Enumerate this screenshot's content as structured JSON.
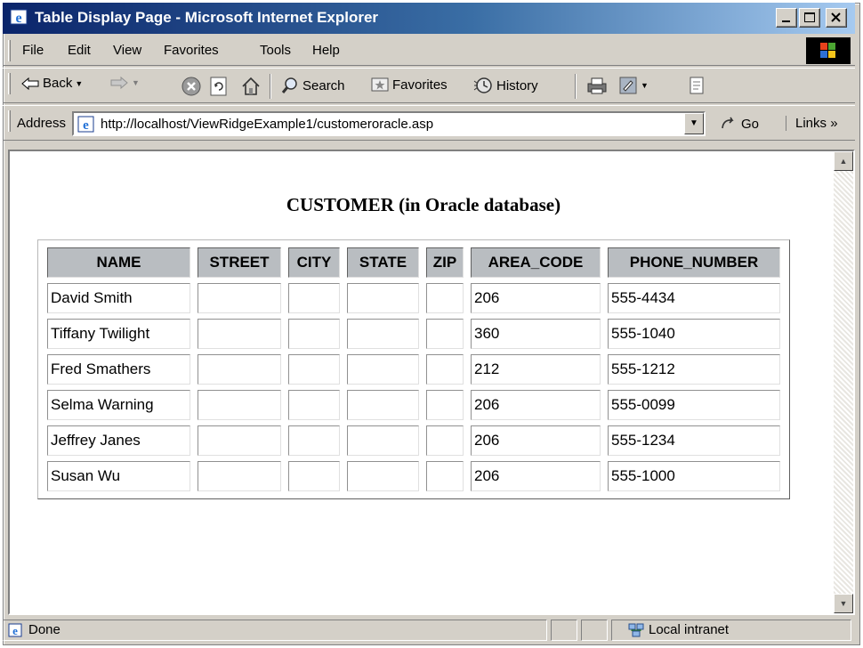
{
  "window": {
    "title": "Table Display Page - Microsoft Internet Explorer"
  },
  "menu": [
    "File",
    "Edit",
    "View",
    "Favorites",
    "Tools",
    "Help"
  ],
  "toolbar": {
    "back": "Back",
    "search": "Search",
    "favorites": "Favorites",
    "history": "History"
  },
  "address": {
    "label": "Address",
    "url": "http://localhost/ViewRidgeExample1/customeroracle.asp",
    "go": "Go",
    "links": "Links"
  },
  "page": {
    "heading": "CUSTOMER (in Oracle database)",
    "columns": [
      "NAME",
      "STREET",
      "CITY",
      "STATE",
      "ZIP",
      "AREA_CODE",
      "PHONE_NUMBER"
    ],
    "rows": [
      [
        "David Smith",
        "",
        "",
        "",
        "",
        "206",
        "555-4434"
      ],
      [
        "Tiffany Twilight",
        "",
        "",
        "",
        "",
        "360",
        "555-1040"
      ],
      [
        "Fred Smathers",
        "",
        "",
        "",
        "",
        "212",
        "555-1212"
      ],
      [
        "Selma Warning",
        "",
        "",
        "",
        "",
        "206",
        "555-0099"
      ],
      [
        "Jeffrey Janes",
        "",
        "",
        "",
        "",
        "206",
        "555-1234"
      ],
      [
        "Susan Wu",
        "",
        "",
        "",
        "",
        "206",
        "555-1000"
      ]
    ]
  },
  "status": {
    "text": "Done",
    "zone": "Local intranet"
  },
  "colors": {
    "titlebar_start": "#0a246a",
    "titlebar_end": "#a6caf0",
    "chrome": "#d4d0c8",
    "header_bg": "#b9bdc1"
  }
}
